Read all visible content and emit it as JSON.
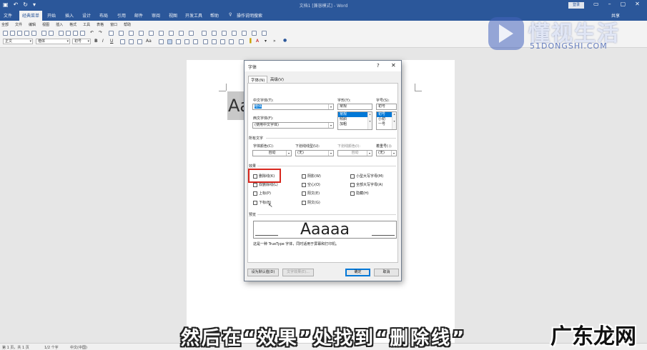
{
  "titlebar": {
    "doc_title": "文档1 [兼容模式] - Word",
    "login": "登录"
  },
  "ribbon_tabs": [
    "文件",
    "经典菜单",
    "开始",
    "插入",
    "设计",
    "布局",
    "引用",
    "邮件",
    "审阅",
    "视图",
    "开发工具",
    "帮助",
    "操作说明搜索"
  ],
  "share": "共享",
  "menu_row": [
    "全部",
    "文件",
    "编辑",
    "视图",
    "插入",
    "格式",
    "工具",
    "表格",
    "窗口",
    "帮助"
  ],
  "toolbar": {
    "style_combo": "正文",
    "font_combo": "楷体",
    "size_combo": "初号"
  },
  "document": {
    "sample_text": "Aa"
  },
  "dialog": {
    "title": "字体",
    "help": "?",
    "close": "✕",
    "tabs": [
      "字体(N)",
      "高级(V)"
    ],
    "chinese_font_label": "中文字体(T):",
    "chinese_font_value": "楷体",
    "western_font_label": "西文字体(F):",
    "western_font_value": "(使用中文字体)",
    "style_label": "字形(Y):",
    "style_value": "常规",
    "style_options": [
      "常规",
      "倾斜",
      "加粗"
    ],
    "size_label": "字号(S):",
    "size_value": "初号",
    "size_options": [
      "初号",
      "小初",
      "一号"
    ],
    "all_text_label": "所有文字",
    "font_color_label": "字体颜色(C):",
    "font_color_value": "自动",
    "underline_type_label": "下划线线型(U):",
    "underline_type_value": "(无)",
    "underline_color_label": "下划线颜色(I):",
    "underline_color_value": "自动",
    "emphasis_label": "着重号(·):",
    "emphasis_value": "(无)",
    "effects_label": "效果",
    "effects": {
      "col1": [
        "删除线(K)",
        "双删除线(L)",
        "上标(P)",
        "下标(B)"
      ],
      "col2": [
        "阴影(W)",
        "空心(O)",
        "阳文(E)",
        "阴文(G)"
      ],
      "col3": [
        "小型大写字母(M)",
        "全部大写字母(A)",
        "隐藏(H)"
      ]
    },
    "preview_label": "预览",
    "preview_text": "Aaaaa",
    "preview_note": "这是一种 TrueType 字体，同时适用于屏幕和打印机。",
    "buttons": {
      "set_default": "设为默认值(D)",
      "text_effects": "文字效果(E)...",
      "ok": "确定",
      "cancel": "取消"
    }
  },
  "statusbar": {
    "page": "第 1 页，共 1 页",
    "words": "1/2 个字",
    "lang": "中文(中国)"
  },
  "watermark": {
    "logo_cn": "懂视生活",
    "logo_en": "51DONGSHI.COM",
    "corner": "广东龙网"
  },
  "subtitle": "然后在“效果”处找到“删除线”",
  "colors": {
    "word_blue": "#2b579a",
    "highlight_red": "#d8281f",
    "selection_blue": "#0078d7"
  }
}
